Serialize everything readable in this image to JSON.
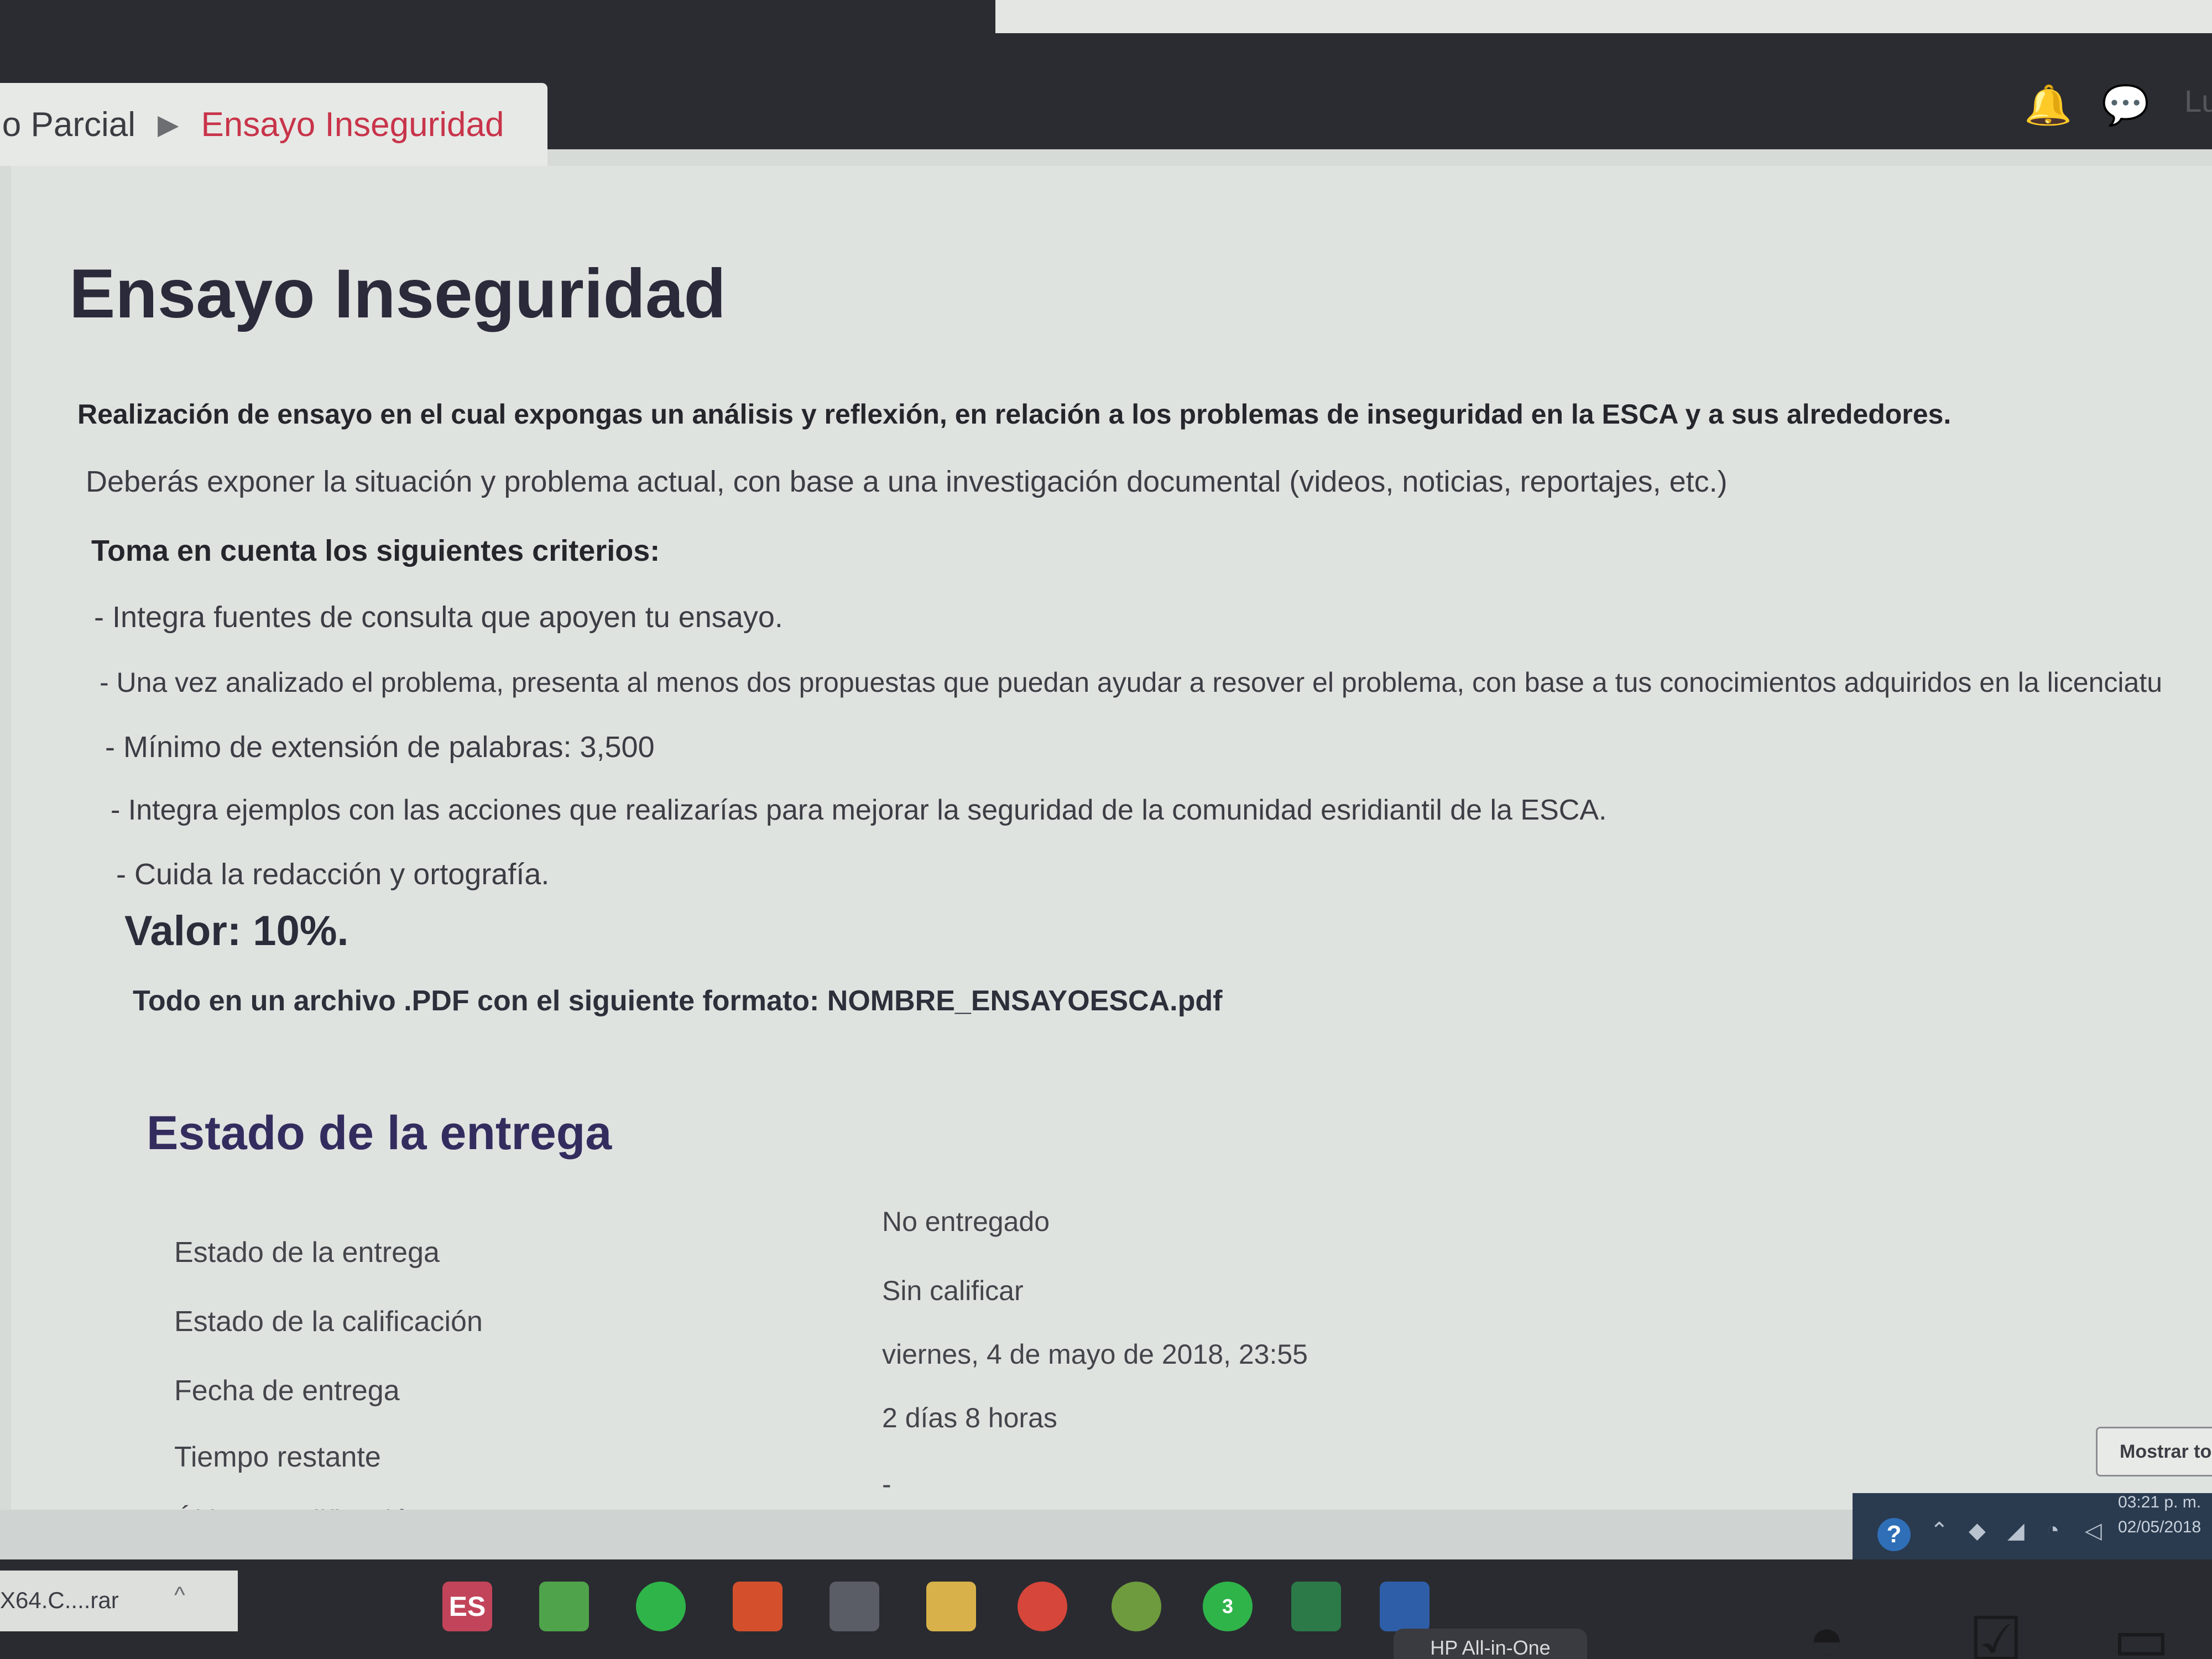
{
  "breadcrumb": {
    "parent": "lo Parcial",
    "separator": "▶",
    "current": "Ensayo Inseguridad"
  },
  "header_icons": [
    "bell-icon",
    "chat-icon"
  ],
  "header_user_partial": "Lu",
  "assignment": {
    "title": "Ensayo Inseguridad",
    "intro_bold": "Realización de ensayo en el cual expongas un análisis y reflexión, en relación a los problemas de inseguridad en la ESCA y a sus alrededores.",
    "intro_text": "Deberás exponer la situación y problema actual, con base a una investigación documental (videos, noticias, reportajes, etc.)",
    "criteria_heading": "Toma en cuenta los siguientes criterios:",
    "criteria": [
      "- Integra fuentes de consulta que apoyen tu ensayo.",
      "- Una vez analizado el problema, presenta al menos dos propuestas que puedan ayudar a resover el problema, con base a tus conocimientos adquiridos en la licenciatu",
      "- Mínimo de extensión de palabras: 3,500",
      "- Integra ejemplos con las acciones que realizarías para mejorar la seguridad de la comunidad esridiantil de la ESCA.",
      "- Cuida la redacción y ortografía."
    ],
    "value_label": "Valor: 10%.",
    "format_note": "Todo en un archivo .PDF con el siguiente formato: NOMBRE_ENSAYOESCA.pdf"
  },
  "submission_status": {
    "heading": "Estado de la entrega",
    "rows": [
      {
        "label": "Estado de la entrega",
        "value": "No entregado"
      },
      {
        "label": "Estado de la calificación",
        "value": "Sin calificar"
      },
      {
        "label": "Fecha de entrega",
        "value": "viernes, 4 de mayo de 2018, 23:55"
      },
      {
        "label": "Tiempo restante",
        "value": "2 días 8 horas"
      },
      {
        "label": "Última modificación",
        "value": "-"
      }
    ]
  },
  "show_all_button": "Mostrar to",
  "download_bar": {
    "file": "X64.C....rar",
    "caret": "^"
  },
  "system_tray": {
    "time": "03:21 p. m.",
    "date": "02/05/2018",
    "help_icon": "?"
  },
  "taskbar_apps": [
    {
      "name": "es-app",
      "label": "ES",
      "color": "#c2445a"
    },
    {
      "name": "camtasia",
      "label": "",
      "color": "#4fa34a"
    },
    {
      "name": "whatsapp",
      "label": "",
      "color": "#2fb44a"
    },
    {
      "name": "powerpoint",
      "label": "",
      "color": "#d4502c"
    },
    {
      "name": "moodle",
      "label": "",
      "color": "#5a5d66"
    },
    {
      "name": "file-explorer",
      "label": "",
      "color": "#d8b14a"
    },
    {
      "name": "chrome",
      "label": "",
      "color": "#d6463a"
    },
    {
      "name": "maps",
      "label": "",
      "color": "#6e9b3e"
    },
    {
      "name": "whatsapp-badge",
      "label": "3",
      "color": "#2fb44a"
    },
    {
      "name": "excel",
      "label": "",
      "color": "#2b7a48"
    },
    {
      "name": "word",
      "label": "",
      "color": "#2f5ea8"
    }
  ],
  "monitor_brand": "HP All-in-One"
}
